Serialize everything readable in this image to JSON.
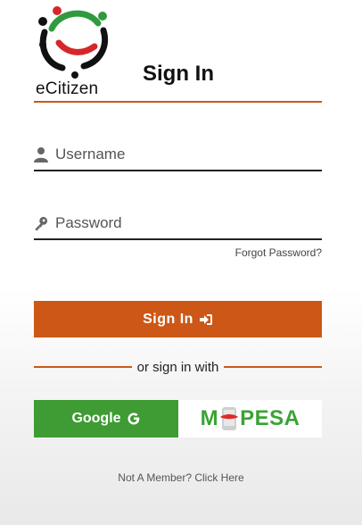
{
  "brand": {
    "logo_text": "eCitizen",
    "colors": {
      "black": "#111111",
      "red": "#d7262b",
      "green": "#2f9b3c"
    }
  },
  "title": "Sign In",
  "form": {
    "username_placeholder": "Username",
    "password_placeholder": "Password",
    "forgot_label": "Forgot Password?"
  },
  "buttons": {
    "signin_label": "Sign In",
    "signin_icon": "sign-in-arrow-icon",
    "divider_text": "or sign in with",
    "google_label": "Google",
    "google_icon": "google-g-icon",
    "mpesa_label_left": "M",
    "mpesa_label_right": "PESA"
  },
  "footer": {
    "member_label": "Not A Member? Click Here"
  },
  "colors": {
    "accent": "#cd5716",
    "google_green": "#3f9b33",
    "mpesa_green": "#3aa335"
  }
}
